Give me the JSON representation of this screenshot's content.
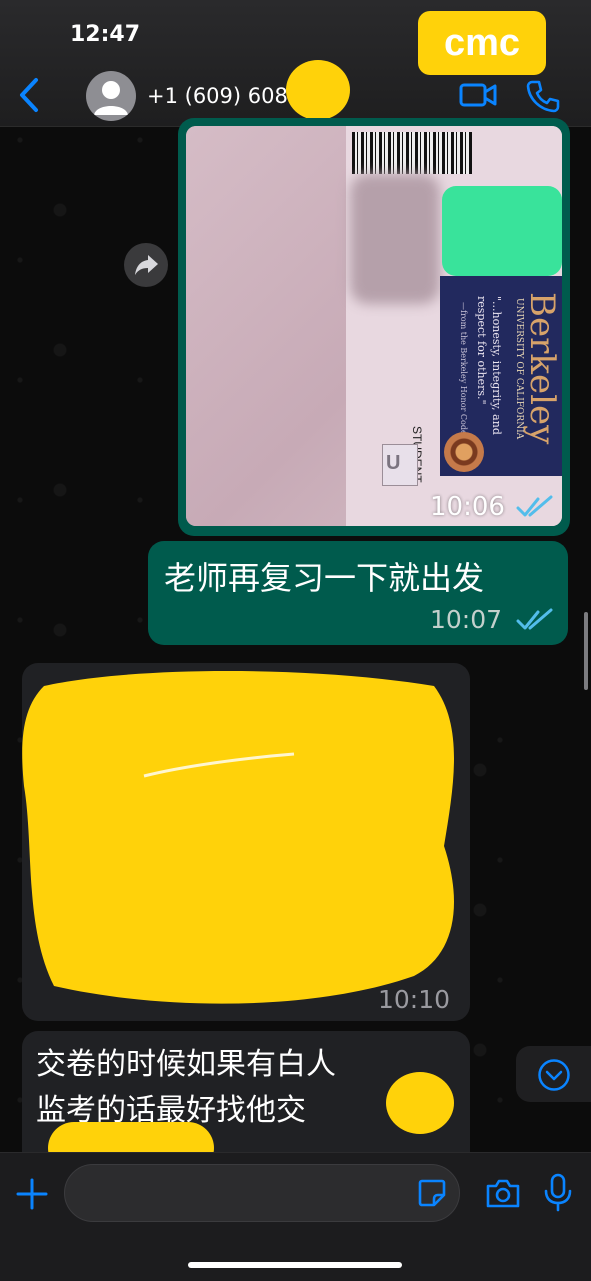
{
  "status_bar": {
    "time": "12:47"
  },
  "watermark": {
    "label": "cmc"
  },
  "header": {
    "back_icon": "chevron-left-icon",
    "contact_name": "+1 (609) 608",
    "video_icon": "video-camera-icon",
    "call_icon": "phone-icon",
    "accent": "#0a84ff"
  },
  "messages": [
    {
      "type": "image",
      "direction": "outgoing",
      "time": "10:06",
      "read": true,
      "image_text": {
        "school": "Berkeley",
        "university": "UNIVERSITY OF CALIFORNIA",
        "quote": "\"...honesty, integrity, and respect for others.\"",
        "quote_source": "—from the Berkeley Honor Code",
        "card_label": "STUDENT",
        "card_letter": "U"
      }
    },
    {
      "type": "text",
      "direction": "outgoing",
      "text": "老师再复习一下就出发",
      "time": "10:07",
      "read": true
    },
    {
      "type": "text",
      "direction": "incoming",
      "text": "",
      "redacted": true,
      "time": "10:10"
    },
    {
      "type": "text",
      "direction": "incoming",
      "lines": [
        "交卷的时候如果有白人",
        "监考的话最好找他交"
      ],
      "partially_redacted": true
    }
  ],
  "forward_icon": "forward-arrow-icon",
  "scroll_down_icon": "chevron-down-circle-icon",
  "input_bar": {
    "plus_icon": "plus-icon",
    "placeholder": "",
    "sticker_icon": "sticker-icon",
    "camera_icon": "camera-icon",
    "mic_icon": "microphone-icon"
  },
  "colors": {
    "outgoing_bubble": "#005b4d",
    "incoming_bubble": "#202124",
    "redaction": "#ffd20a",
    "read_ticks": "#53bdeb"
  }
}
